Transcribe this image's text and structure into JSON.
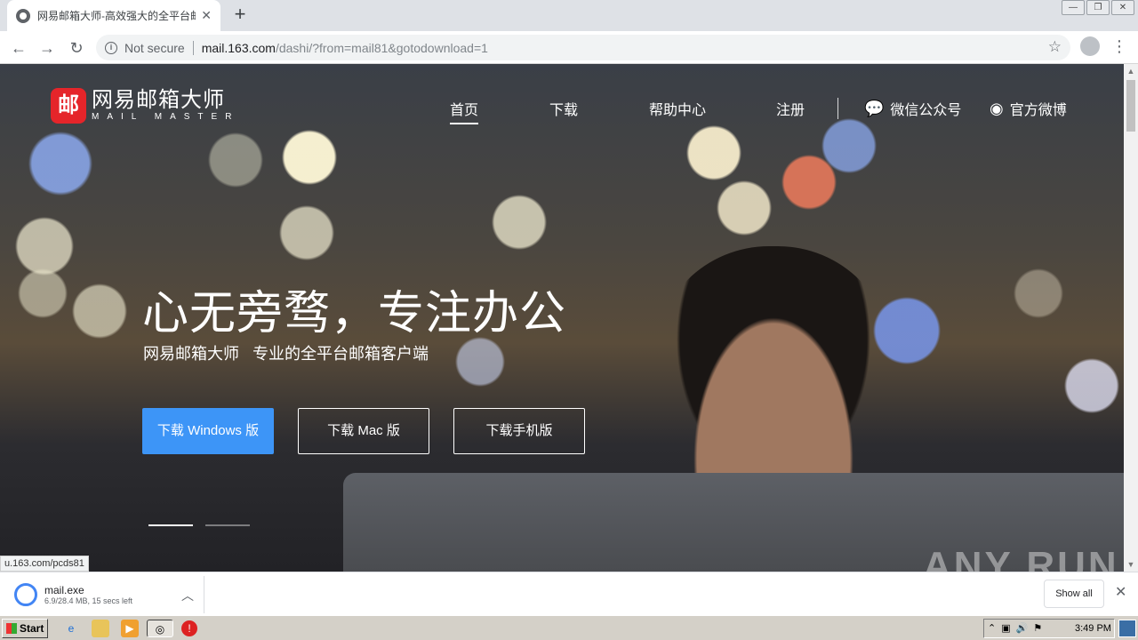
{
  "browser": {
    "tab_title": "网易邮箱大师-高效强大的全平台邮箱",
    "security": "Not secure",
    "url_host": "mail.163.com",
    "url_path": "/dashi/?from=mail81&gotodownload=1"
  },
  "site": {
    "logo_mark": "邮",
    "logo_cn": "网易邮箱大师",
    "logo_en": "MAIL MASTER",
    "nav": {
      "home": "首页",
      "download": "下载",
      "help": "帮助中心",
      "register": "注册",
      "wechat": "微信公众号",
      "weibo": "官方微博"
    },
    "headline": "心无旁骛，专注办公",
    "subline": "网易邮箱大师   专业的全平台邮箱客户端",
    "buttons": {
      "windows": "下载 Windows 版",
      "mac": "下载 Mac 版",
      "mobile": "下载手机版"
    },
    "carousel": {
      "slides": 2,
      "active": 1
    }
  },
  "status_url": "u.163.com/pcds81",
  "watermark": "ANY RUN",
  "download_bar": {
    "file_name": "mail.exe",
    "status": "6.9/28.4 MB, 15 secs left",
    "show_all": "Show all"
  },
  "taskbar": {
    "start": "Start",
    "clock": "3:49 PM"
  },
  "colors": {
    "accent_blue": "#3d95f7",
    "logo_red": "#e5252a"
  }
}
